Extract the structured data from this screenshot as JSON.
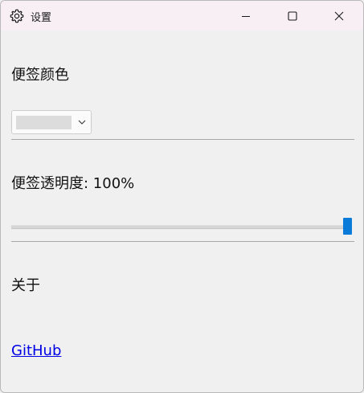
{
  "window": {
    "title": "设置"
  },
  "sections": {
    "color_label": "便签颜色",
    "color_select": {
      "selected_color": "#dcdcdc"
    },
    "opacity_label_prefix": "便签透明度: ",
    "opacity_value": "100%",
    "opacity_fraction": 1.0,
    "about_label": "关于",
    "github_link": "GitHub"
  },
  "colors": {
    "accent": "#0a7bd8",
    "link": "#0000e6",
    "titlebar": "#f7eff3",
    "background": "#f0f0f0"
  },
  "icons": {
    "title": "gear-icon",
    "minimize": "minimize-icon",
    "maximize": "maximize-icon",
    "close": "close-icon",
    "dropdown": "chevron-down-icon"
  }
}
